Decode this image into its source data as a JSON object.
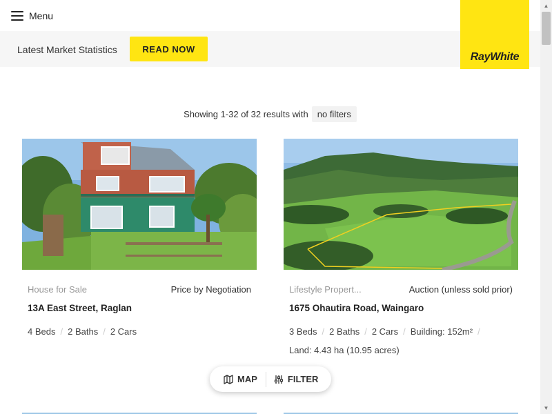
{
  "header": {
    "menu_label": "Menu",
    "logo_text": "RayWhite",
    "brand_color": "#ffe512"
  },
  "stats_bar": {
    "text": "Latest Market Statistics",
    "button_label": "READ NOW"
  },
  "results": {
    "summary": "Showing 1-32 of 32 results with",
    "filter_chip": "no filters"
  },
  "listings": [
    {
      "type": "House for Sale",
      "price": "Price by Negotiation",
      "address": "13A East Street, Raglan",
      "beds": "4 Beds",
      "baths": "2 Baths",
      "cars": "2 Cars"
    },
    {
      "type": "Lifestyle Propert...",
      "price": "Auction (unless sold prior)",
      "address": "1675 Ohautira Road, Waingaro",
      "beds": "3 Beds",
      "baths": "2 Baths",
      "cars": "2 Cars",
      "building": "Building: 152m²",
      "land": "Land: 4.43 ha (10.95 acres)"
    }
  ],
  "floating_bar": {
    "map_label": "MAP",
    "filter_label": "FILTER"
  },
  "icons": {
    "menu": "hamburger-icon",
    "map": "map-icon",
    "filter": "sliders-icon"
  }
}
